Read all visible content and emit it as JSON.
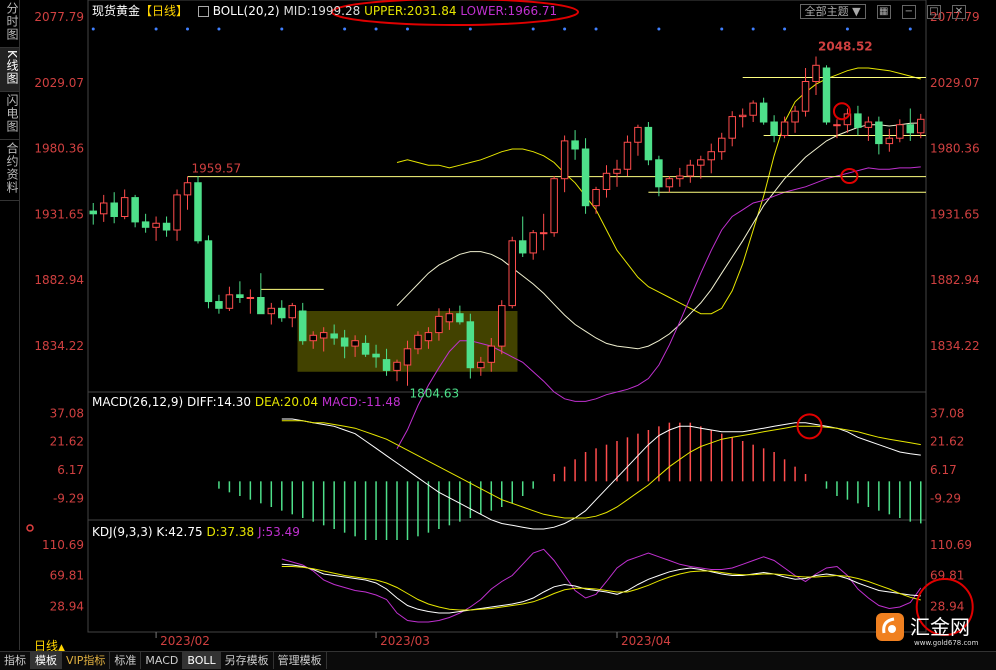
{
  "side_tabs": [
    {
      "label": "分时图"
    },
    {
      "label": "K线图"
    },
    {
      "label": "闪电图"
    },
    {
      "label": "合约资料"
    }
  ],
  "header": {
    "title": "现货黄金",
    "period": "【日线】",
    "boll_name": "BOLL(20,2)",
    "mid": "MID:1999.28",
    "upper": "UPPER:2031.84",
    "lower": "LOWER:1966.71",
    "all_topics": "全部主题"
  },
  "macd_header": {
    "name": "MACD(26,12,9)",
    "diff": "DIFF:14.30",
    "dea": "DEA:20.04",
    "macd": "MACD:-11.48"
  },
  "kdj_header": {
    "name": "KDJ(9,3,3)",
    "k": "K:42.75",
    "d": "D:37.38",
    "j": "J:53.49"
  },
  "price_axis": [
    "2077.79",
    "2029.07",
    "1980.36",
    "1931.65",
    "1882.94",
    "1834.22"
  ],
  "macd_axis": [
    "37.08",
    "21.62",
    "6.17",
    "-9.29"
  ],
  "kdj_axis": [
    "110.69",
    "69.81",
    "28.94"
  ],
  "x_labels": [
    {
      "idx": 6,
      "label": "2023/02"
    },
    {
      "idx": 27,
      "label": "2023/03"
    },
    {
      "idx": 50,
      "label": "2023/04"
    }
  ],
  "annotations": {
    "high": "2048.52",
    "early_high": "1959.57",
    "low": "1804.63"
  },
  "day_label": "日线",
  "bottom_tabs": [
    {
      "label": "指标"
    },
    {
      "label": "模板",
      "active": true
    },
    {
      "label": "VIP指标",
      "vip": true
    },
    {
      "label": "标准"
    },
    {
      "label": "MACD"
    },
    {
      "label": "BOLL",
      "active": true
    },
    {
      "label": "另存模板"
    },
    {
      "label": "管理模板"
    }
  ],
  "logo": {
    "text": "汇金网",
    "url": "www.gold678.com"
  },
  "colors": {
    "up": "#ff4d4d",
    "down": "#4ee08a",
    "upper": "#e6e600",
    "mid": "#f0f0d0",
    "lower": "#c030d0",
    "dea": "#e6e600",
    "diff": "#ffffff",
    "j": "#c030d0",
    "red_mark": "#e00000",
    "axis": "#d04040"
  },
  "chart_data": {
    "type": "candlestick",
    "y_range": [
      1800,
      2080
    ],
    "ohlc": [
      [
        1934,
        1940,
        1924,
        1932
      ],
      [
        1932,
        1946,
        1926,
        1940
      ],
      [
        1940,
        1948,
        1925,
        1930
      ],
      [
        1930,
        1950,
        1928,
        1944
      ],
      [
        1944,
        1946,
        1922,
        1926
      ],
      [
        1926,
        1932,
        1918,
        1922
      ],
      [
        1922,
        1930,
        1912,
        1925
      ],
      [
        1925,
        1930,
        1915,
        1920
      ],
      [
        1920,
        1950,
        1912,
        1946
      ],
      [
        1946,
        1959.57,
        1935,
        1955
      ],
      [
        1955,
        1960,
        1910,
        1912
      ],
      [
        1912,
        1916,
        1862,
        1867
      ],
      [
        1867,
        1872,
        1858,
        1862
      ],
      [
        1862,
        1878,
        1860,
        1872
      ],
      [
        1872,
        1882,
        1866,
        1870
      ],
      [
        1870,
        1876,
        1858,
        1870
      ],
      [
        1870,
        1888,
        1860,
        1858
      ],
      [
        1858,
        1866,
        1850,
        1862
      ],
      [
        1862,
        1868,
        1852,
        1855
      ],
      [
        1855,
        1866,
        1848,
        1864
      ],
      [
        1860,
        1866,
        1835,
        1838
      ],
      [
        1838,
        1845,
        1832,
        1842
      ],
      [
        1840,
        1848,
        1830,
        1844
      ],
      [
        1843,
        1850,
        1835,
        1840
      ],
      [
        1840,
        1846,
        1825,
        1834
      ],
      [
        1834,
        1842,
        1826,
        1838
      ],
      [
        1836,
        1842,
        1826,
        1828
      ],
      [
        1828,
        1835,
        1818,
        1826
      ],
      [
        1824,
        1832,
        1812,
        1816
      ],
      [
        1816,
        1824,
        1808,
        1822
      ],
      [
        1820,
        1838,
        1804.63,
        1832
      ],
      [
        1832,
        1845,
        1828,
        1842
      ],
      [
        1838,
        1848,
        1832,
        1844
      ],
      [
        1844,
        1862,
        1838,
        1856
      ],
      [
        1852,
        1862,
        1846,
        1858
      ],
      [
        1858,
        1864,
        1850,
        1852
      ],
      [
        1852,
        1858,
        1810,
        1818
      ],
      [
        1818,
        1826,
        1812,
        1822
      ],
      [
        1822,
        1840,
        1815,
        1834
      ],
      [
        1834,
        1868,
        1828,
        1864
      ],
      [
        1864,
        1915,
        1862,
        1912
      ],
      [
        1912,
        1930,
        1900,
        1903
      ],
      [
        1903,
        1920,
        1898,
        1918
      ],
      [
        1918,
        1932,
        1905,
        1918
      ],
      [
        1918,
        1960,
        1915,
        1958
      ],
      [
        1958,
        1990,
        1948,
        1986
      ],
      [
        1986,
        1994,
        1972,
        1980
      ],
      [
        1980,
        1988,
        1932,
        1938
      ],
      [
        1938,
        1952,
        1932,
        1950
      ],
      [
        1950,
        1968,
        1944,
        1962
      ],
      [
        1962,
        1972,
        1952,
        1965
      ],
      [
        1965,
        1990,
        1960,
        1985
      ],
      [
        1985,
        1998,
        1975,
        1996
      ],
      [
        1996,
        2000,
        1968,
        1972
      ],
      [
        1972,
        1975,
        1945,
        1952
      ],
      [
        1952,
        1960,
        1948,
        1958
      ],
      [
        1958,
        1966,
        1952,
        1960
      ],
      [
        1960,
        1972,
        1955,
        1968
      ],
      [
        1968,
        1975,
        1958,
        1972
      ],
      [
        1972,
        1984,
        1962,
        1978
      ],
      [
        1978,
        1992,
        1972,
        1988
      ],
      [
        1988,
        2008,
        1982,
        2004
      ],
      [
        2004,
        2010,
        1996,
        2005
      ],
      [
        2005,
        2016,
        2000,
        2014
      ],
      [
        2014,
        2018,
        1998,
        2000
      ],
      [
        2000,
        2005,
        1985,
        1990
      ],
      [
        1990,
        2004,
        1988,
        2000
      ],
      [
        2000,
        2012,
        1992,
        2008
      ],
      [
        2008,
        2040,
        2004,
        2030
      ],
      [
        2030,
        2048.52,
        2020,
        2042
      ],
      [
        2040,
        2042,
        1998,
        2000
      ],
      [
        1998,
        2002,
        1988,
        1998
      ],
      [
        1998,
        2010,
        1992,
        2006
      ],
      [
        2006,
        2012,
        1990,
        1996
      ],
      [
        1996,
        2004,
        1986,
        2000
      ],
      [
        2000,
        2004,
        1976,
        1984
      ],
      [
        1984,
        1995,
        1978,
        1988
      ],
      [
        1988,
        2002,
        1985,
        1998
      ],
      [
        1998,
        2010,
        1986,
        1992
      ],
      [
        1992,
        2006,
        1988,
        2002
      ]
    ],
    "bollinger": {
      "upper": [
        1970,
        1972,
        1970,
        1968,
        1968,
        1966,
        1968,
        1970,
        1972,
        1975,
        1978,
        1980,
        1980,
        1978,
        1975,
        1970,
        1962,
        1955,
        1945,
        1935,
        1920,
        1905,
        1895,
        1885,
        1878,
        1874,
        1870,
        1866,
        1862,
        1858,
        1858,
        1862,
        1875,
        1895,
        1920,
        1945,
        1975,
        2000,
        2015,
        2022,
        2028,
        2032,
        2035,
        2038,
        2040,
        2040,
        2039,
        2038,
        2036,
        2034,
        2031.84
      ],
      "upper_start": 10,
      "mid": [
        1864,
        1872,
        1880,
        1888,
        1894,
        1898,
        1902,
        1904,
        1904,
        1902,
        1898,
        1892,
        1886,
        1880,
        1873,
        1865,
        1857,
        1850,
        1845,
        1840,
        1836,
        1834,
        1833,
        1832,
        1834,
        1838,
        1843,
        1850,
        1858,
        1866,
        1876,
        1888,
        1900,
        1912,
        1925,
        1938,
        1948,
        1958,
        1966,
        1974,
        1980,
        1986,
        1990,
        1993,
        1996,
        1998,
        1998,
        1997,
        1998,
        1999,
        1999.28
      ],
      "lower": [
        1758,
        1772,
        1790,
        1805,
        1818,
        1830,
        1838,
        1838,
        1836,
        1834,
        1830,
        1826,
        1822,
        1815,
        1808,
        1800,
        1795,
        1793,
        1793,
        1795,
        1798,
        1800,
        1802,
        1805,
        1810,
        1820,
        1835,
        1852,
        1870,
        1888,
        1905,
        1920,
        1930,
        1935,
        1940,
        1942,
        1945,
        1948,
        1950,
        1952,
        1955,
        1958,
        1960,
        1962,
        1964,
        1966,
        1965,
        1965,
        1966,
        1966,
        1966.71
      ]
    },
    "horizontal_levels": [
      {
        "y": 1959.57,
        "from": 9,
        "to": 83
      },
      {
        "y": 2033,
        "from": 62,
        "to": 83
      },
      {
        "y": 1990,
        "from": 64,
        "to": 83
      },
      {
        "y": 1948,
        "from": 53,
        "to": 83
      },
      {
        "y": 1876,
        "from": 16,
        "to": 22
      }
    ],
    "consolidation_box": {
      "x_from": 20,
      "x_to": 40,
      "y_from": 1815,
      "y_to": 1860
    },
    "macd": {
      "hist": [
        -2,
        -3,
        -4,
        -5,
        -6,
        -7,
        -8,
        -9,
        -10,
        -11,
        -12,
        -13,
        -14,
        -15,
        -16,
        -16,
        -16,
        -16,
        -16,
        -15,
        -14,
        -13,
        -12,
        -11,
        -10,
        -9,
        -8,
        -7,
        -6,
        -4,
        -2,
        0,
        2,
        4,
        6,
        8,
        9,
        10,
        11,
        12,
        13,
        14,
        15,
        16,
        16,
        16,
        15,
        14,
        13,
        12,
        11,
        10,
        9,
        8,
        6,
        4,
        2,
        0,
        -2,
        -4,
        -5,
        -6,
        -7,
        -8,
        -9,
        -10,
        -11,
        -11.48
      ],
      "hist_scale": 2.0,
      "diff": [
        34,
        34,
        33,
        32,
        31,
        30,
        28,
        26,
        22,
        18,
        14,
        10,
        6,
        2,
        -2,
        -6,
        -9,
        -12,
        -15,
        -18,
        -21,
        -23,
        -24,
        -25,
        -26,
        -26,
        -25,
        -23,
        -20,
        -16,
        -10,
        -4,
        2,
        8,
        14,
        20,
        25,
        28,
        30,
        30,
        29,
        28,
        27,
        27,
        27,
        28,
        29,
        30,
        31,
        32,
        32,
        31,
        30,
        29,
        27,
        24,
        22,
        20,
        18,
        16,
        15,
        14.3
      ],
      "dea": [
        33,
        33,
        33,
        32,
        32,
        31,
        30,
        29,
        27,
        25,
        23,
        20,
        17,
        14,
        11,
        8,
        5,
        2,
        -1,
        -4,
        -7,
        -10,
        -12,
        -14,
        -16,
        -18,
        -19,
        -20,
        -20,
        -20,
        -19,
        -17,
        -14,
        -10,
        -6,
        -2,
        3,
        8,
        12,
        16,
        19,
        21,
        23,
        24,
        25,
        26,
        27,
        28,
        29,
        30,
        30,
        30,
        29.5,
        29,
        28,
        27,
        25.5,
        24,
        23,
        22,
        21,
        20.04
      ],
      "y_range": [
        -20,
        40
      ]
    },
    "kdj": {
      "k": [
        85,
        84,
        82,
        78,
        72,
        70,
        68,
        66,
        64,
        60,
        52,
        40,
        30,
        25,
        22,
        20,
        20,
        22,
        24,
        26,
        28,
        30,
        32,
        35,
        40,
        48,
        55,
        58,
        56,
        52,
        50,
        48,
        45,
        50,
        58,
        65,
        70,
        75,
        78,
        80,
        78,
        75,
        72,
        70,
        70,
        72,
        74,
        72,
        68,
        65,
        66,
        70,
        72,
        70,
        66,
        60,
        55,
        50,
        48,
        46,
        44,
        42.75
      ],
      "d": [
        82,
        82,
        81,
        79,
        76,
        73,
        70,
        68,
        66,
        64,
        60,
        54,
        46,
        38,
        32,
        28,
        25,
        24,
        24,
        25,
        26,
        28,
        30,
        32,
        35,
        40,
        46,
        51,
        53,
        53,
        52,
        50,
        48,
        48,
        52,
        57,
        63,
        68,
        72,
        75,
        76,
        76,
        74,
        72,
        71,
        71,
        72,
        72,
        71,
        69,
        68,
        68,
        69,
        70,
        69,
        66,
        62,
        57,
        52,
        46,
        41,
        37.38
      ],
      "j": [
        92,
        88,
        84,
        76,
        64,
        58,
        54,
        50,
        48,
        44,
        38,
        20,
        10,
        8,
        8,
        10,
        14,
        20,
        28,
        38,
        52,
        62,
        70,
        85,
        100,
        105,
        90,
        70,
        50,
        40,
        45,
        62,
        80,
        90,
        95,
        100,
        95,
        90,
        85,
        82,
        80,
        78,
        78,
        80,
        85,
        90,
        95,
        90,
        80,
        70,
        62,
        72,
        80,
        82,
        70,
        52,
        40,
        30,
        26,
        28,
        34,
        53.49
      ],
      "y_range": [
        0,
        120
      ]
    }
  }
}
